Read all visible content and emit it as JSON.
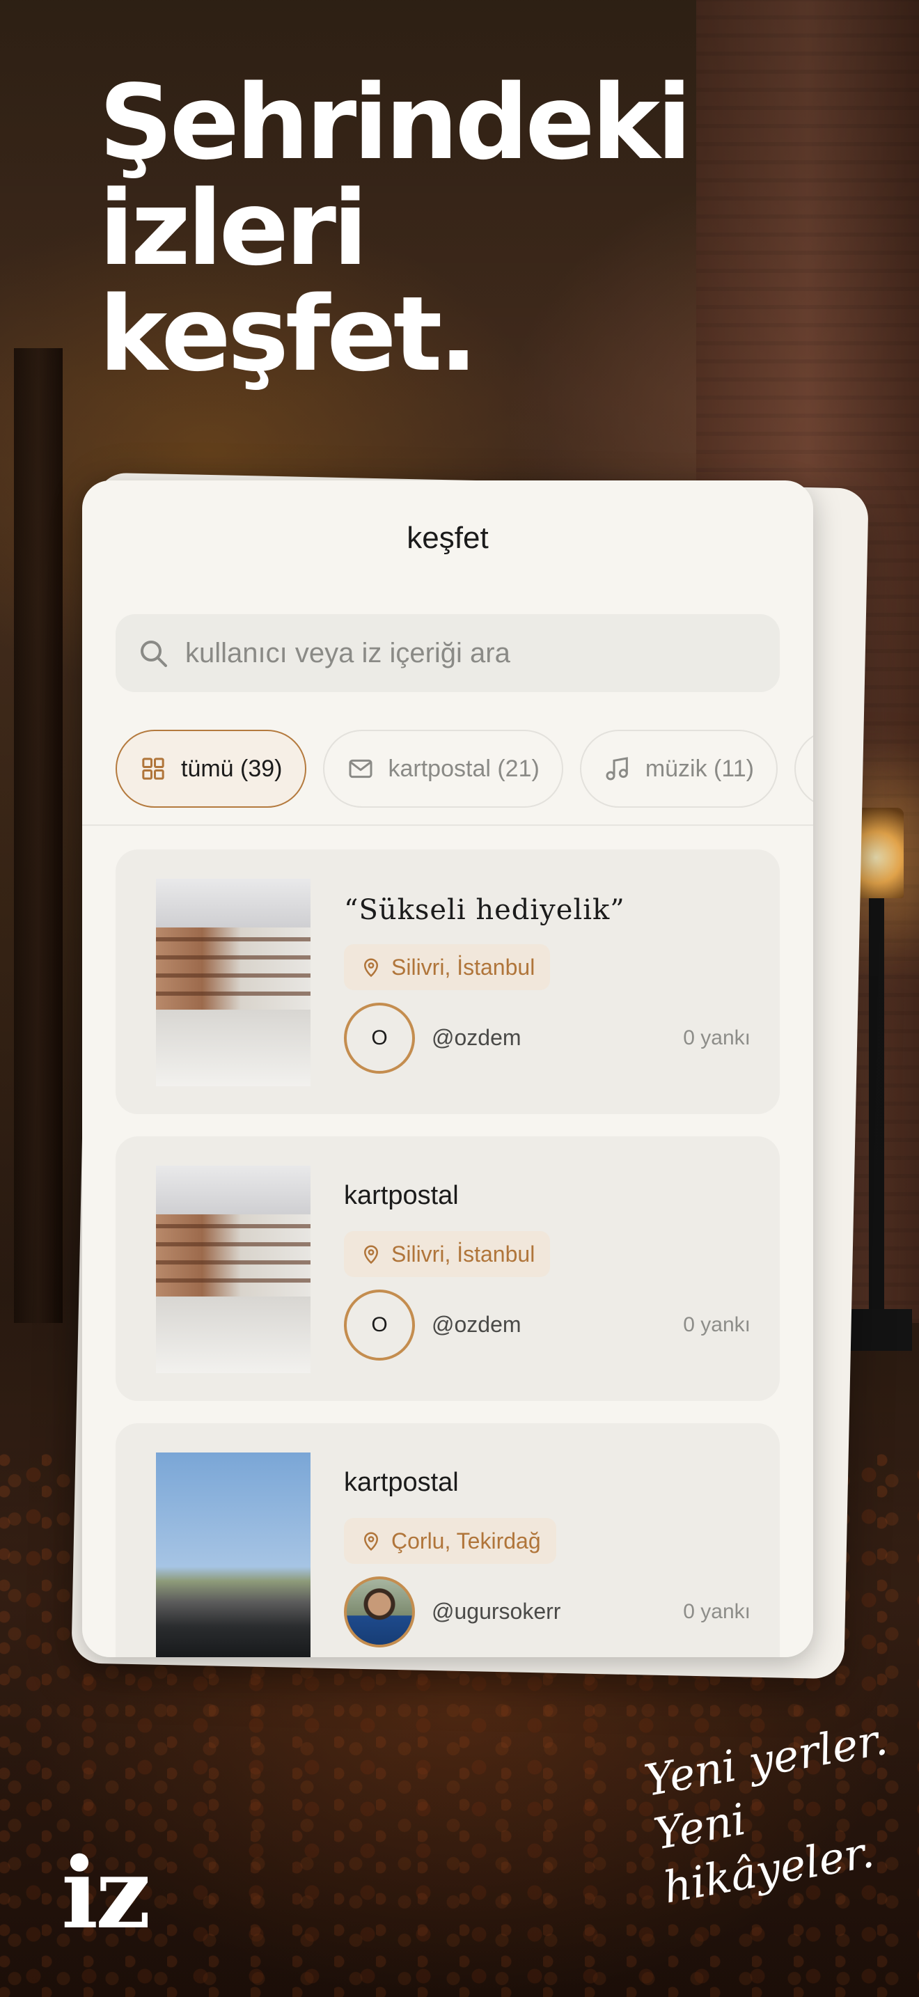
{
  "headline": [
    "Şehrindeki",
    "izleri",
    "keşfet."
  ],
  "screen": {
    "title": "keşfet",
    "search": {
      "placeholder": "kullanıcı veya iz içeriği ara",
      "icon": "search-icon"
    },
    "filters": [
      {
        "label": "tümü (39)",
        "icon": "grid-icon",
        "active": true
      },
      {
        "label": "kartpostal (21)",
        "icon": "envelope-icon",
        "active": false
      },
      {
        "label": "müzik (11)",
        "icon": "music-note-icon",
        "active": false
      }
    ],
    "items": [
      {
        "title": "“Sükseli hediyelik”",
        "location": "Silivri, İstanbul",
        "avatar_initial": "O",
        "username": "@ozdem",
        "replies": "0 yankı"
      },
      {
        "title": "kartpostal",
        "location": "Silivri, İstanbul",
        "avatar_initial": "O",
        "username": "@ozdem",
        "replies": "0 yankı"
      },
      {
        "title": "kartpostal",
        "location": "Çorlu, Tekirdağ",
        "avatar_initial": "",
        "username": "@ugursokerr",
        "replies": "0 yankı"
      }
    ]
  },
  "brand": {
    "logo": "iz",
    "tagline": [
      "Yeni yerler.",
      "Yeni hikâyeler."
    ]
  },
  "colors": {
    "accent": "#b0753a",
    "card": "#f7f5f0",
    "item": "#eeece7",
    "location_bg": "#f1e7db"
  }
}
